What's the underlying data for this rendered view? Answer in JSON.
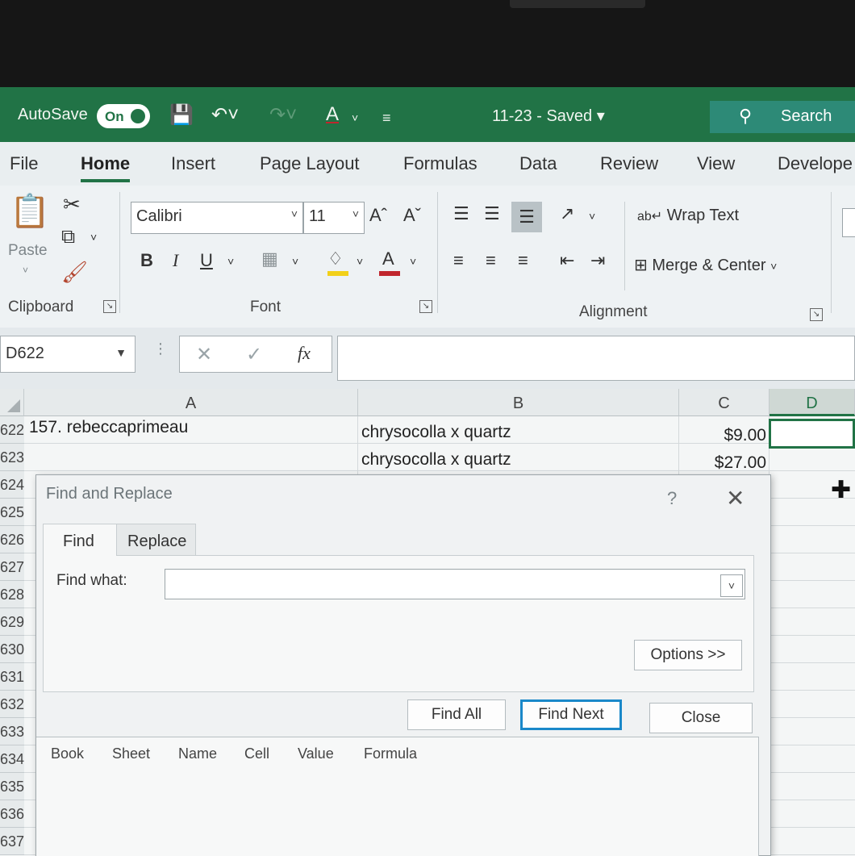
{
  "titlebar": {
    "autosave_label": "AutoSave",
    "autosave_state": "On",
    "document_title": "11-23  -  Saved  ▾",
    "search_placeholder": "Search"
  },
  "ribbon_tabs": [
    "File",
    "Home",
    "Insert",
    "Page Layout",
    "Formulas",
    "Data",
    "Review",
    "View",
    "Develope"
  ],
  "ribbon": {
    "clipboard": {
      "paste_label": "Paste",
      "group_label": "Clipboard"
    },
    "font": {
      "font_name": "Calibri",
      "font_size": "11",
      "group_label": "Font",
      "bold": "B",
      "italic": "I",
      "underline": "U",
      "grow": "Aˆ",
      "shrink": "Aˇ",
      "font_color_letter": "A",
      "fill_color": "#f2d019",
      "font_color": "#c0262d"
    },
    "alignment": {
      "wrap_text": "Wrap Text",
      "merge_center": "Merge & Center",
      "group_label": "Alignment"
    }
  },
  "formula_bar": {
    "name_box": "D622",
    "cancel": "✕",
    "enter": "✓",
    "fx": "fx",
    "value": ""
  },
  "sheet": {
    "columns": [
      "A",
      "B",
      "C",
      "D"
    ],
    "rows": [
      {
        "num": "622",
        "a": "157. rebeccaprimeau",
        "b": "chrysocolla x quartz",
        "c": "$9.00"
      },
      {
        "num": "623",
        "a": "",
        "b": "chrysocolla x quartz",
        "c": "$27.00"
      },
      {
        "num": "624",
        "a": "",
        "b": "",
        "c": ""
      },
      {
        "num": "625 1",
        "a": "",
        "b": "",
        "c": ""
      },
      {
        "num": "626",
        "a": "",
        "b": "",
        "c": ""
      },
      {
        "num": "627",
        "a": "",
        "b": "",
        "c": ""
      },
      {
        "num": "628 1",
        "a": "",
        "b": "",
        "c": ""
      },
      {
        "num": "629",
        "a": "",
        "b": "",
        "c": ""
      },
      {
        "num": "630",
        "a": "",
        "b": "",
        "c": ""
      },
      {
        "num": "631",
        "a": "",
        "b": "",
        "c": ""
      },
      {
        "num": "632 1",
        "a": "",
        "b": "",
        "c": ""
      },
      {
        "num": "633",
        "a": "",
        "b": "",
        "c": ""
      },
      {
        "num": "634 1",
        "a": "",
        "b": "",
        "c": ""
      },
      {
        "num": "635",
        "a": "",
        "b": "",
        "c": ""
      },
      {
        "num": "636",
        "a": "",
        "b": "",
        "c": ""
      },
      {
        "num": "637",
        "a": "",
        "b": "",
        "c": ""
      }
    ]
  },
  "dialog": {
    "title": "Find and Replace",
    "help": "?",
    "close": "✕",
    "tabs": [
      "Find",
      "Replace"
    ],
    "find_what_label": "Find what:",
    "find_what_value": "",
    "options_button": "Options >>",
    "find_all_button": "Find All",
    "find_next_button": "Find Next",
    "close_button": "Close",
    "result_columns": [
      "Book",
      "Sheet",
      "Name",
      "Cell",
      "Value",
      "Formula"
    ]
  }
}
